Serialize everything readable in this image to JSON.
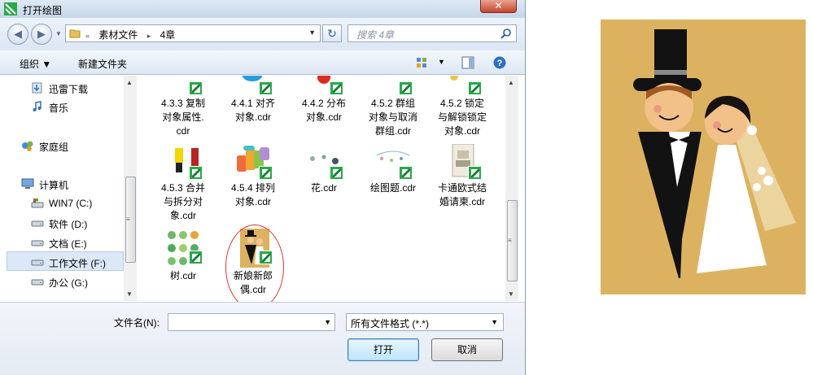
{
  "dialog": {
    "title": "打开绘图",
    "close_label": "✕"
  },
  "navbar": {
    "back": "◀",
    "forward": "▶",
    "breadcrumb": [
      "«",
      "素材文件",
      "▸",
      "4章"
    ],
    "refresh_glyph": "↻",
    "search_placeholder": "搜索 4章"
  },
  "toolbar": {
    "organize": "组织 ▼",
    "new_folder": "新建文件夹",
    "view_dd": "▼"
  },
  "sidebar": {
    "items": [
      {
        "label": "迅雷下载",
        "icon": "download-folder-icon"
      },
      {
        "label": "音乐",
        "icon": "music-icon"
      },
      {
        "label": "家庭组",
        "icon": "homegroup-icon"
      },
      {
        "label": "计算机",
        "icon": "computer-icon"
      },
      {
        "label": "WIN7 (C:)",
        "icon": "system-drive-icon"
      },
      {
        "label": "软件 (D:)",
        "icon": "drive-icon"
      },
      {
        "label": "文档 (E:)",
        "icon": "drive-icon"
      },
      {
        "label": "工作文件 (F:)",
        "icon": "drive-icon"
      },
      {
        "label": "办公 (G:)",
        "icon": "drive-icon"
      }
    ],
    "selected": "工作文件 (F:)"
  },
  "files": [
    {
      "name": "4.3.3 复制对象属性.cdr",
      "line1": "4.3.3  复制",
      "line2": "对象属性.",
      "line3": "cdr"
    },
    {
      "name": "4.4.1 对齐对象.cdr",
      "line1": "4.4.1  对齐",
      "line2": "对象.cdr",
      "line3": ""
    },
    {
      "name": "4.4.2 分布对象.cdr",
      "line1": "4.4.2 分布",
      "line2": "对象.cdr",
      "line3": ""
    },
    {
      "name": "4.5.2 群组对象与取消群组.cdr",
      "line1": "4.5.2  群组",
      "line2": "对象与取消",
      "line3": "群组.cdr"
    },
    {
      "name": "4.5.2 锁定与解锁锁定对象.cdr",
      "line1": "4.5.2  锁定",
      "line2": "与解锁锁定",
      "line3": "对象.cdr"
    },
    {
      "name": "4.5.3 合并与拆分对象.cdr",
      "line1": "4.5.3  合并",
      "line2": "与拆分对",
      "line3": "象.cdr"
    },
    {
      "name": "4.5.4 排列对象.cdr",
      "line1": "4.5.4  排列",
      "line2": "对象.cdr",
      "line3": ""
    },
    {
      "name": "花.cdr",
      "line1": "花.cdr",
      "line2": "",
      "line3": ""
    },
    {
      "name": "绘图题.cdr",
      "line1": "绘图题.cdr",
      "line2": "",
      "line3": ""
    },
    {
      "name": "卡通欧式结婚请柬.cdr",
      "line1": "卡通欧式结",
      "line2": "婚请柬.cdr",
      "line3": ""
    },
    {
      "name": "树.cdr",
      "line1": "树.cdr",
      "line2": "",
      "line3": ""
    },
    {
      "name": "新娘新郎偶.cdr",
      "line1": "新娘新郎",
      "line2": "偶.cdr",
      "line3": ""
    }
  ],
  "footer": {
    "filename_label": "文件名(N):",
    "filename_value": "",
    "filter_value": "所有文件格式 (*.*)",
    "open_label": "打开",
    "cancel_label": "取消"
  },
  "colors": {
    "illustration_bg": "#dcb261",
    "annotation": "#d43a3a",
    "cdr_badge": "#2aa84a"
  }
}
